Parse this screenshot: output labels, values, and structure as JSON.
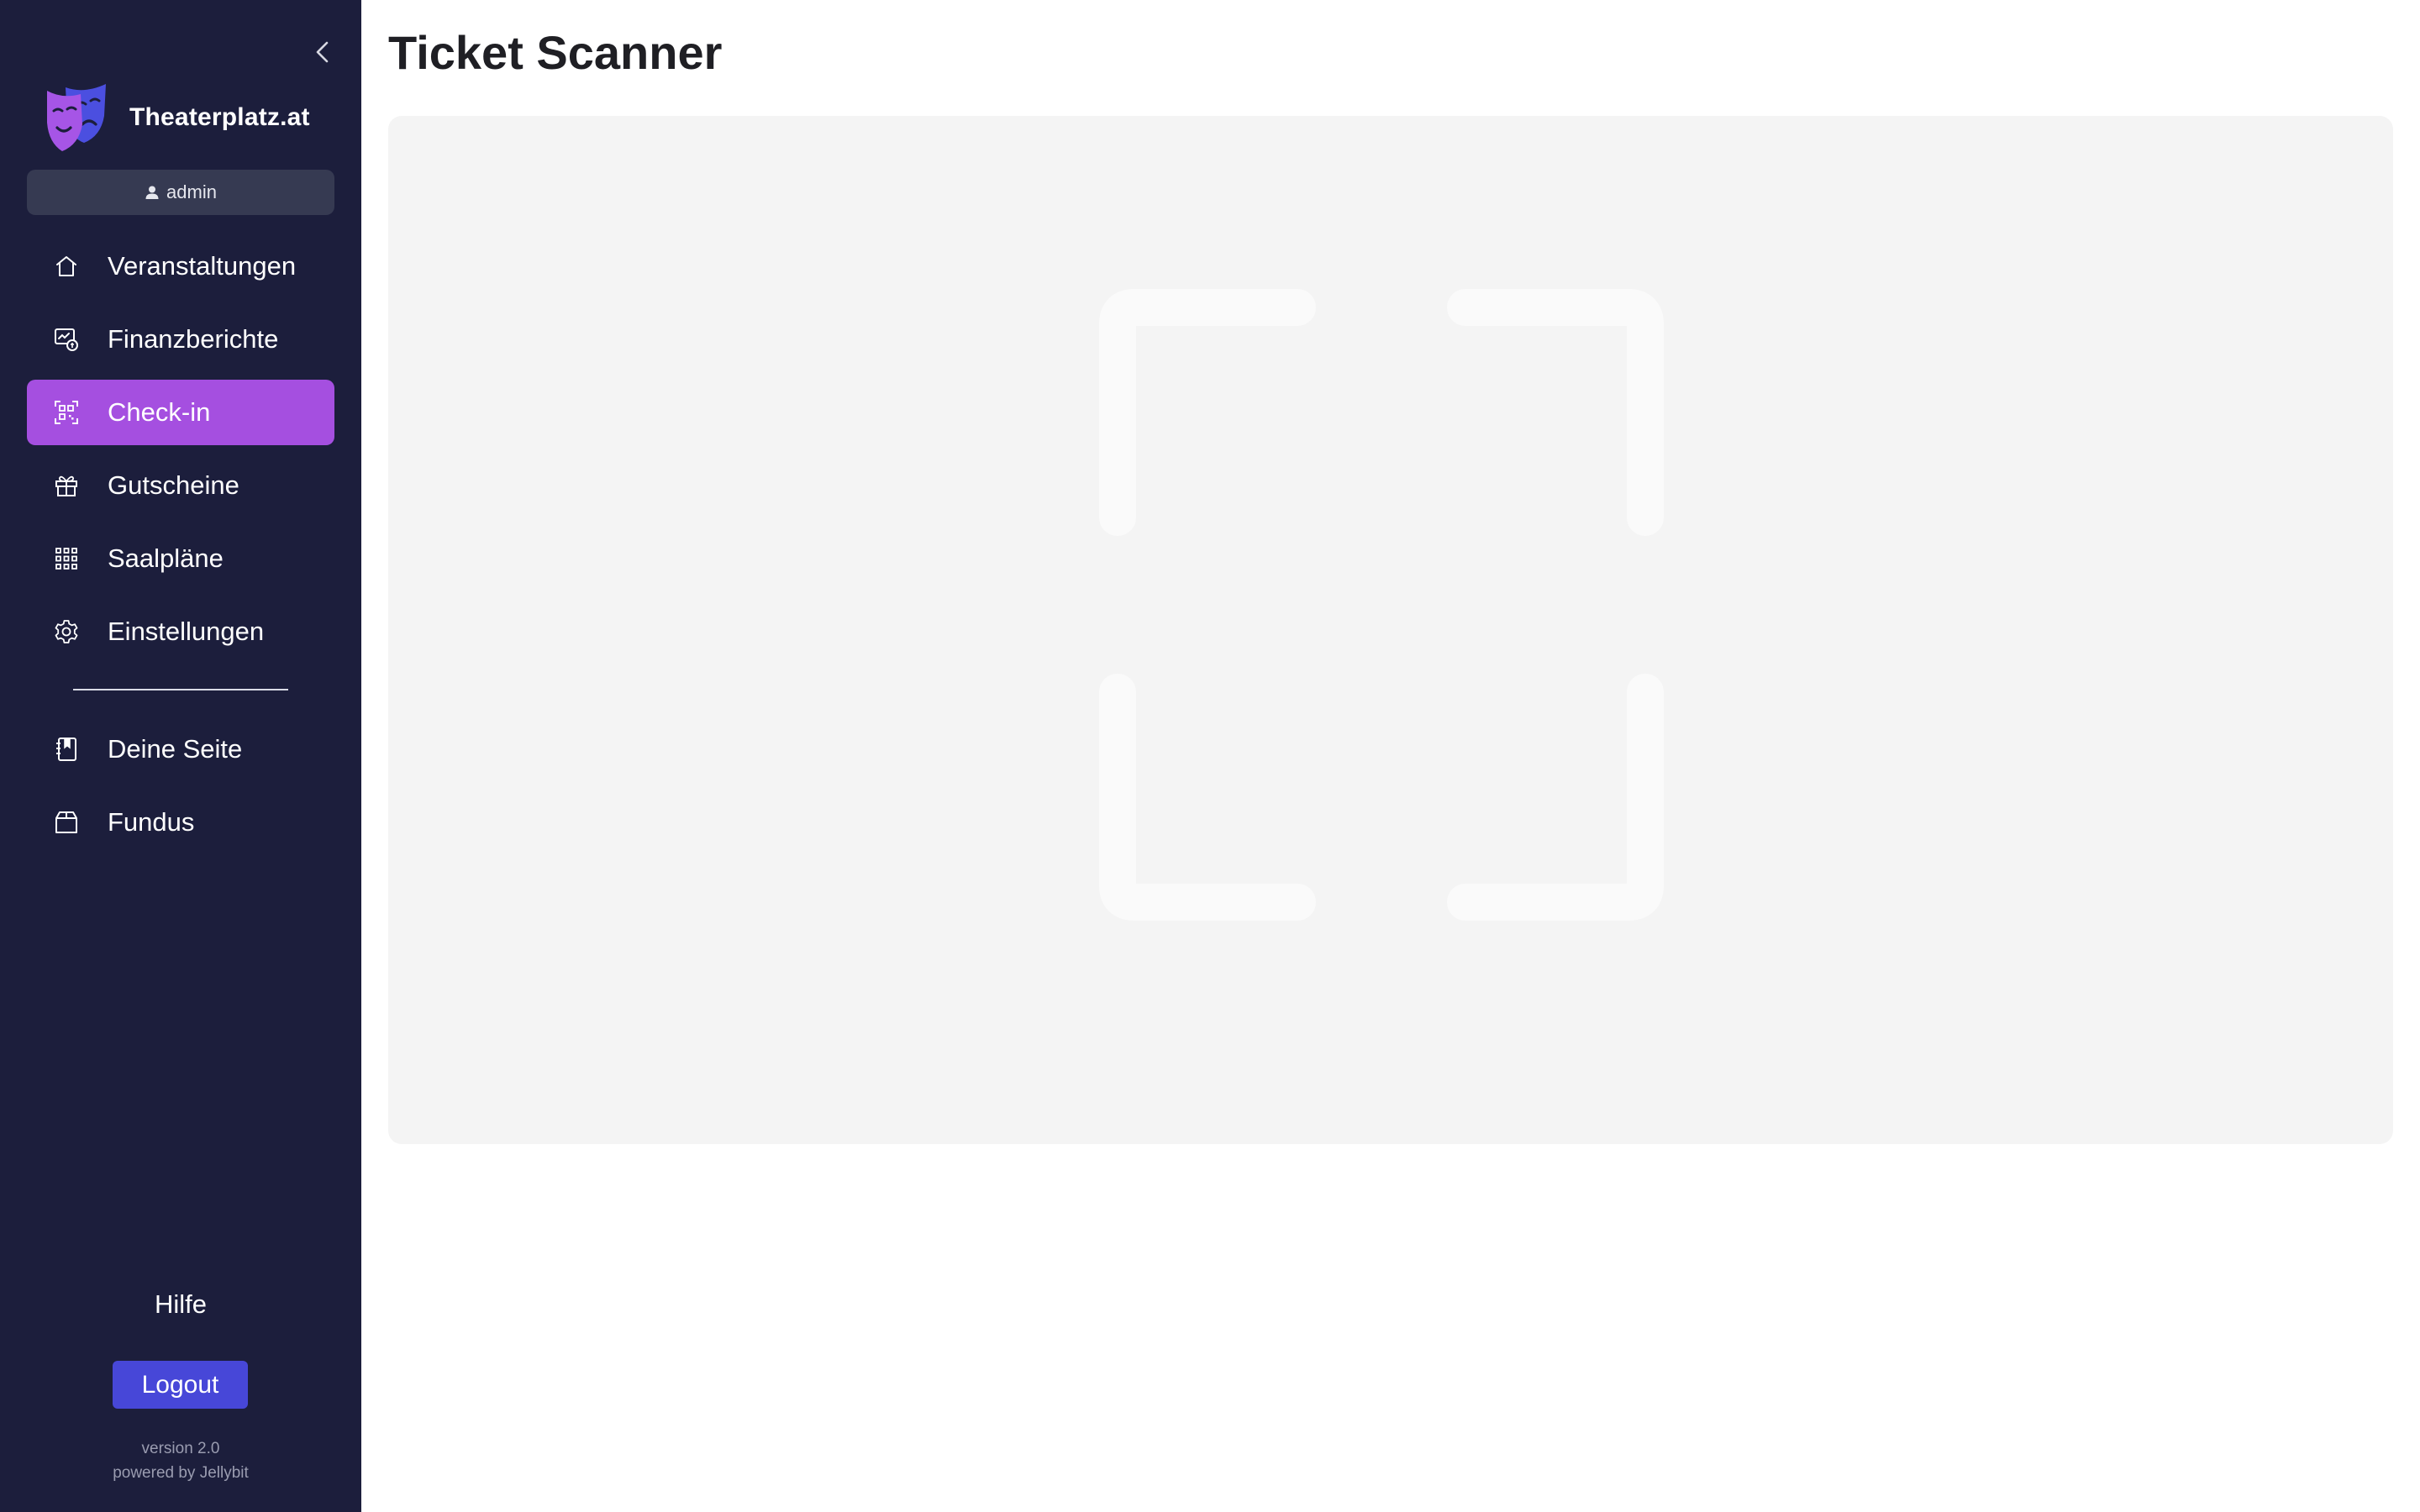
{
  "sidebar": {
    "brand": {
      "name": "Theaterplatz.at",
      "logo_icon": "theater-masks-icon"
    },
    "user": {
      "name": "admin",
      "icon": "user-icon"
    },
    "collapse_icon": "chevron-left-icon",
    "items": [
      {
        "label": "Veranstaltungen",
        "icon": "home-icon",
        "active": false
      },
      {
        "label": "Finanzberichte",
        "icon": "finance-report-icon",
        "active": false
      },
      {
        "label": "Check-in",
        "icon": "qr-scan-icon",
        "active": true
      },
      {
        "label": "Gutscheine",
        "icon": "gift-icon",
        "active": false
      },
      {
        "label": "Saalpläne",
        "icon": "grid-icon",
        "active": false
      },
      {
        "label": "Einstellungen",
        "icon": "gear-icon",
        "active": false
      }
    ],
    "items2": [
      {
        "label": "Deine Seite",
        "icon": "page-icon"
      },
      {
        "label": "Fundus",
        "icon": "box-icon"
      }
    ],
    "help_label": "Hilfe",
    "logout_label": "Logout",
    "version": "version 2.0",
    "powered_by": "powered by Jellybit"
  },
  "main": {
    "title": "Ticket Scanner",
    "scanner_icon": "scan-frame-icon"
  },
  "colors": {
    "sidebar_bg": "#1c1e3c",
    "active_item": "#a54fe0",
    "logout_button": "#4747d8",
    "user_pill": "#363a52",
    "scanner_bg": "#f4f4f4",
    "logo_purple": "#a655e6",
    "logo_blue": "#4b4fe0"
  }
}
